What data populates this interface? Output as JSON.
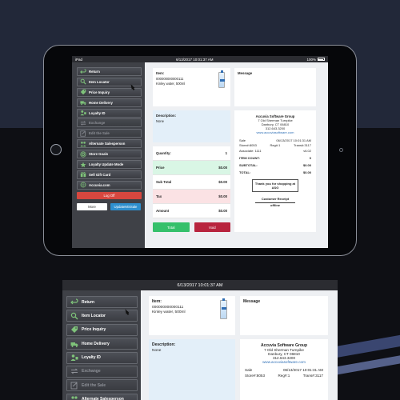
{
  "device": {
    "label": "iPad",
    "time": "6/13/2017 10:01:37 AM",
    "battery": "100%"
  },
  "menu": [
    {
      "label": "Return",
      "icon": "return-icon",
      "disabled": false
    },
    {
      "label": "Item Locator",
      "icon": "item-locator-icon",
      "disabled": false
    },
    {
      "label": "Price Inquiry",
      "icon": "price-inquiry-icon",
      "disabled": false
    },
    {
      "label": "Home Delivery",
      "icon": "delivery-truck-icon",
      "disabled": false
    },
    {
      "label": "Loyalty ID",
      "icon": "loyalty-id-icon",
      "disabled": false
    },
    {
      "label": "Exchange",
      "icon": "exchange-icon",
      "disabled": true
    },
    {
      "label": "Edit the Sale",
      "icon": "edit-sale-icon",
      "disabled": true
    },
    {
      "label": "Alternate Salesperson",
      "icon": "salesperson-icon",
      "disabled": false
    },
    {
      "label": "Store Goals",
      "icon": "store-goals-icon",
      "disabled": false
    },
    {
      "label": "Loyalty Update Mode",
      "icon": "loyalty-update-icon",
      "disabled": false
    },
    {
      "label": "Sell Gift Card",
      "icon": "gift-card-icon",
      "disabled": false
    },
    {
      "label": "Accuvia.com",
      "icon": "web-icon",
      "disabled": false
    }
  ],
  "logoff_label": "Log Off",
  "more_label": "More",
  "update_label": "UpdateMSSale",
  "item": {
    "label": "Item:",
    "code": "000000000000111",
    "name": "Kinley water, 500ml"
  },
  "description": {
    "label": "Description:",
    "value": "None"
  },
  "totals": {
    "quantity_label": "Quantity:",
    "quantity": "1",
    "price_label": "Price",
    "price": "$0.00",
    "subtotal_label": "Sub Total",
    "subtotal": "$0.00",
    "tax_label": "Tax",
    "tax": "$0.00",
    "amount_label": "Amount",
    "amount": "$0.00"
  },
  "total_button": "Total",
  "void_button": "Void",
  "message": {
    "label": "Message"
  },
  "receipt": {
    "company": "Accuvia Software Group",
    "address1": "7 Old Sherman Turnpike",
    "address2": "Danbury, CT 06810",
    "phone": "312.643.3200",
    "url": "www.accuviasoftware.com",
    "sale_label": "Sale",
    "sale_time": "06/13/2017 10:01:31 AM",
    "store": "Store#:8053",
    "reg": "Reg#:1",
    "trans": "Trans#:3117",
    "associate": "Associate: 1111",
    "version": "v6.02",
    "item_count_label": "ITEM COUNT:",
    "item_count": "0",
    "subtotal_label": "SUBTOTAL:",
    "subtotal": "$0.00",
    "total_label": "TOTAL:",
    "total": "$0.00",
    "thanks": "Thank you for shopping at ASG",
    "customer_receipt": "Customer Receipt",
    "offline": "offline"
  },
  "colors": {
    "accent_blue": "#2e8fce",
    "logoff_red": "#d7473f",
    "total_green": "#35c06b",
    "void_red": "#b8243e"
  }
}
